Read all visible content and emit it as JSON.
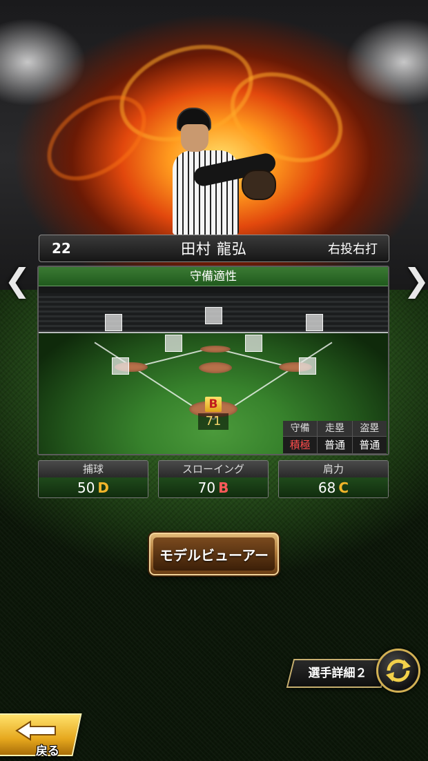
{
  "player": {
    "number": "22",
    "name": "田村 龍弘",
    "throw_bat": "右投右打"
  },
  "nav": {
    "prev_glyph": "❮",
    "next_glyph": "❯"
  },
  "defense": {
    "title": "守備適性",
    "catcher_grade": "B",
    "catcher_value": "71",
    "table_headers": [
      "守備",
      "走塁",
      "盗塁"
    ],
    "table_values": [
      "積極",
      "普通",
      "普通"
    ]
  },
  "stats": [
    {
      "label": "捕球",
      "value": "50",
      "grade": "D",
      "grade_color": "#f1b52a"
    },
    {
      "label": "スローイング",
      "value": "70",
      "grade": "B",
      "grade_color": "#ff5a5a"
    },
    {
      "label": "肩力",
      "value": "68",
      "grade": "C",
      "grade_color": "#f1b52a"
    }
  ],
  "buttons": {
    "model_viewer": "モデルビューアー",
    "player_detail": "選手詳細２",
    "back": "戻る"
  },
  "icons": {
    "prev": "chevron-left-icon",
    "next": "chevron-right-icon",
    "swap": "swap-icon",
    "back": "back-arrow-icon"
  },
  "colors": {
    "panel_green": "#205a1d",
    "grade_yellow": "#f1b52a",
    "grade_red": "#ff5a5a",
    "button_gold": "#e6a81e"
  }
}
